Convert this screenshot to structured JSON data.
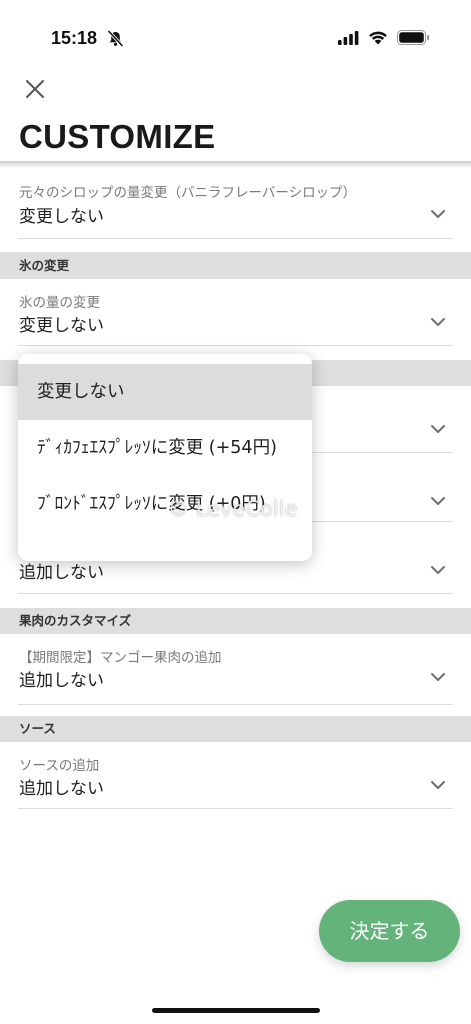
{
  "status_bar": {
    "time": "15:18",
    "icons": [
      "bell-slash-icon",
      "signal-icon",
      "wifi-icon",
      "battery-icon"
    ]
  },
  "header": {
    "close_icon": "close-icon",
    "title": "CUSTOMIZE"
  },
  "sections": [
    {
      "rows": [
        {
          "label": "元々のシロップの量変更（バニラフレーバーシロップ）",
          "value": "変更しない"
        }
      ]
    },
    {
      "header": "氷の変更",
      "rows": [
        {
          "label": "氷の量の変更",
          "value": "変更しない"
        }
      ]
    },
    {
      "rows": [
        {},
        {},
        {
          "value": "追加しない"
        }
      ]
    },
    {
      "header": "果肉のカスタマイズ",
      "rows": [
        {
          "label": "【期間限定】マンゴー果肉の追加",
          "value": "追加しない"
        }
      ]
    },
    {
      "header": "ソース",
      "rows": [
        {
          "label": "ソースの追加",
          "value": "追加しない"
        }
      ]
    }
  ],
  "row_icon": "chevron-down-icon",
  "dropdown": {
    "selected_index": 0,
    "options": [
      "変更しない",
      "ﾃﾞｨｶﾌｪｴｽﾌﾟﾚｯｿに変更 (+54円)",
      "ﾌﾞﾛﾝﾄﾞｴｽﾌﾟﾚｯｿに変更 (+0円)"
    ]
  },
  "watermark": "© LeveColle",
  "footer": {
    "submit_label": "決定する"
  },
  "colors": {
    "accent": "#63b37b",
    "band": "#dedede",
    "selected": "#dcdcdc"
  }
}
